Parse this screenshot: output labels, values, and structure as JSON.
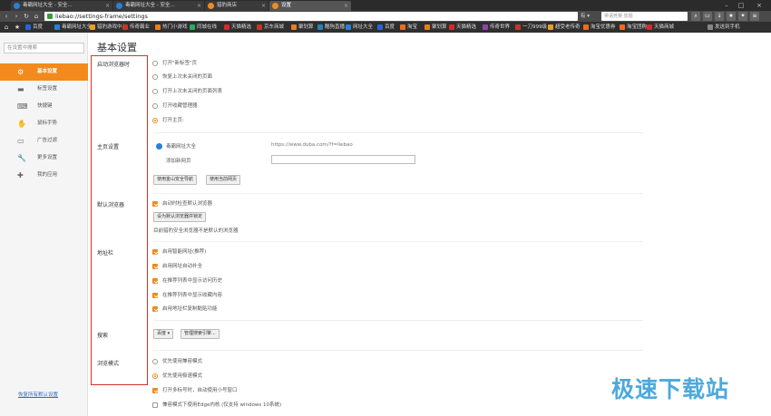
{
  "tabs": [
    {
      "title": "毒霸网址大全 - 安全...",
      "active": false
    },
    {
      "title": "毒霸网址大全 - 安全...",
      "active": false
    },
    {
      "title": "猎豹商店",
      "active": false
    },
    {
      "title": "设置",
      "active": true
    }
  ],
  "address_bar": {
    "url": "liebao://settings-frame/settings",
    "engine": "有 ▾",
    "search_placeholder": "英语竞赛·放题"
  },
  "bookmarks": [
    {
      "label": "百度",
      "color": "#2b62d9"
    },
    {
      "label": "毒霸网址大全",
      "color": "#2b7fd6"
    },
    {
      "label": "猎豹游戏中心",
      "color": "#e8a020"
    },
    {
      "label": "传奇霸业",
      "color": "#c0392b"
    },
    {
      "label": "热门小游戏",
      "color": "#e67e22"
    },
    {
      "label": "同城在线",
      "color": "#27ae60"
    },
    {
      "label": "天猫精选",
      "color": "#d6282d"
    },
    {
      "label": "京东商城",
      "color": "#c0392b"
    },
    {
      "label": "聚划算",
      "color": "#e67e22"
    },
    {
      "label": "酷狗直播",
      "color": "#2980b9"
    },
    {
      "label": "网址大全",
      "color": "#2b7fd6"
    },
    {
      "label": "百度",
      "color": "#2b62d9"
    },
    {
      "label": "淘宝",
      "color": "#f26b1d"
    },
    {
      "label": "聚划算",
      "color": "#e67e22"
    },
    {
      "label": "天猫精选",
      "color": "#d6282d"
    },
    {
      "label": "传奇世界",
      "color": "#8e44ad"
    },
    {
      "label": "一刀999级",
      "color": "#c0392b"
    },
    {
      "label": "超受老传奇",
      "color": "#e8a020"
    },
    {
      "label": "淘宝优惠券",
      "color": "#f26b1d"
    },
    {
      "label": "淘宝团购",
      "color": "#f26b1d"
    },
    {
      "label": "天猫商城",
      "color": "#d6282d"
    },
    {
      "label": "发送到手机",
      "color": "#888888"
    }
  ],
  "sidebar": {
    "search_placeholder": "在设置中搜索",
    "items": [
      {
        "label": "基本设置",
        "icon": "⚙",
        "active": true
      },
      {
        "label": "标签设置",
        "icon": "▬",
        "active": false
      },
      {
        "label": "快捷键",
        "icon": "⌨",
        "active": false
      },
      {
        "label": "鼠标手势",
        "icon": "✋",
        "active": false
      },
      {
        "label": "广告过滤",
        "icon": "▭",
        "active": false
      },
      {
        "label": "更多设置",
        "icon": "🔧",
        "active": false
      },
      {
        "label": "我的应用",
        "icon": "✚",
        "active": false
      }
    ],
    "restore_link": "恢复所有默认设置"
  },
  "main": {
    "title": "基本设置",
    "startup": {
      "label": "启动浏览器时",
      "options": [
        {
          "label": "打开\"新标签\"页",
          "selected": false
        },
        {
          "label": "恢复上次未关闭的页面",
          "selected": false
        },
        {
          "label": "打开上次未关闭的页面列表",
          "selected": false
        },
        {
          "label": "打开收藏管理器",
          "selected": false
        },
        {
          "label": "打开主页:",
          "selected": true
        }
      ]
    },
    "homepage": {
      "label": "主页设置",
      "site_name": "毒霸网址大全",
      "site_url": "https://www.duba.com/?f=liebao",
      "add_label": "添加新网页",
      "btn_safe": "使用金山安全导航",
      "btn_current": "使用当前网页"
    },
    "default_browser": {
      "label": "默认浏览器",
      "check_label": "启动时检查默认浏览器",
      "btn_set": "设为默认浏览器并锁定",
      "status": "目前猎豹安全浏览器不是默认的浏览器"
    },
    "address_bar": {
      "label": "地址栏",
      "options": [
        {
          "label": "启用智能网址(推荐)",
          "checked": true
        },
        {
          "label": "启用网址自动补全",
          "checked": true
        },
        {
          "label": "在推荐列表中显示访问历史",
          "checked": true
        },
        {
          "label": "在推荐列表中显示收藏内容",
          "checked": true
        },
        {
          "label": "启用地址栏复制黏贴功能",
          "checked": true
        }
      ]
    },
    "search": {
      "label": "搜索",
      "engine": "百度 ▾",
      "manage_btn": "管理搜索引擎..."
    },
    "mode": {
      "label": "浏览模式",
      "options": [
        {
          "label": "优先使用兼容模式",
          "selected": false
        },
        {
          "label": "优先使用极速模式",
          "selected": true
        }
      ],
      "checks": [
        {
          "label": "打开多标号时，自动使用小号窗口",
          "checked": true
        },
        {
          "label": "兼容模式下使用Edge内核 (仅支持 windows 10系统)",
          "checked": false
        }
      ]
    }
  },
  "watermark": "极速下载站"
}
